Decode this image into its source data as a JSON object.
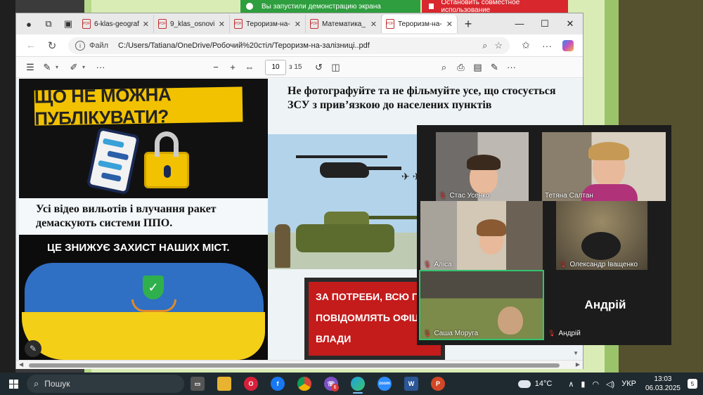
{
  "share_banner": {
    "demo_text": "Вы запустили демонстрацию экрана",
    "stop_text": "Остановить совместное использование"
  },
  "browser": {
    "tabs": [
      {
        "label": "6-klas-geograf"
      },
      {
        "label": "9_klas_osnovi"
      },
      {
        "label": "Тероризм-на-"
      },
      {
        "label": "Математика_"
      },
      {
        "label": "Тероризм-на-"
      }
    ],
    "address": {
      "file_label": "Файл",
      "url": "C:/Users/Tatiana/OneDrive/Робочий%20стіл/Тероризм-на-залізниці..pdf"
    },
    "pdf_toolbar": {
      "page_value": "10",
      "page_total": "з 15"
    }
  },
  "slide": {
    "banner_title": "ЩО НЕ МОЖНА ПУБЛІКУВАТИ?",
    "text_left": "Усі відео вильотів і влучання ракет демаскують системи ППО.",
    "map_title": "ЦЕ ЗНИЖУЄ ЗАХИСТ НАШИХ МІСТ.",
    "heading_right": "Не фотографуйте та не фільмуйте усе, що стосується  ЗСУ з прив’язкою до населених пунктів",
    "red_text": "ЗА ПОТРЕБИ, ВСЮ ПОТ ПОВІДОМЛЯТЬ ОФІЦІ ВЛАДИ"
  },
  "call": {
    "participants": [
      {
        "name": "Стас Усенко"
      },
      {
        "name": "Тетяна Салтан"
      },
      {
        "name": "Аліса"
      },
      {
        "name": "Олександр Іващенко"
      },
      {
        "name": "Саша Моруга"
      },
      {
        "name": "Андрій"
      }
    ],
    "no_video_name": "Андрій"
  },
  "taskbar": {
    "search_placeholder": "Пошук",
    "temperature": "14°C",
    "language": "УКР",
    "time": "13:03",
    "date": "06.03.2025",
    "notifications": "5",
    "viber_badge": "6"
  },
  "colors": {
    "share_green": "#2e9e3e",
    "share_red": "#d9272e",
    "active_speaker": "#33c36e",
    "muted_mic": "#e23a3a"
  },
  "icons": [
    "search-icon",
    "star-icon",
    "copilot-icon",
    "refresh-icon",
    "back-icon",
    "print-icon",
    "draw-icon",
    "highlight-icon",
    "mic-off-icon",
    "windows-icon"
  ]
}
